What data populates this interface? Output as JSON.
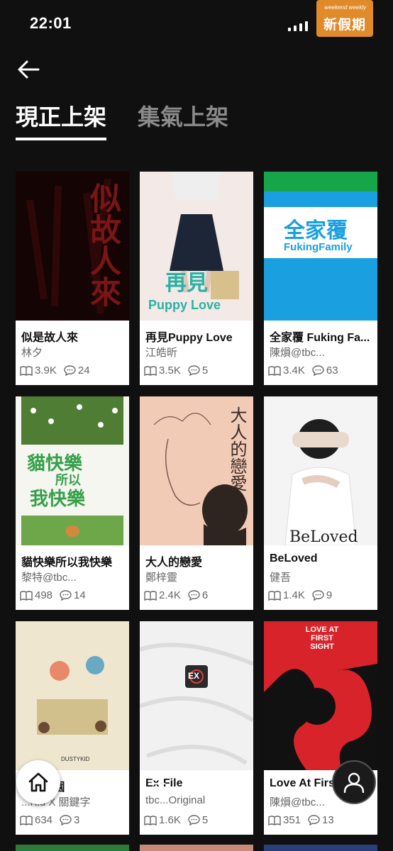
{
  "status_bar": {
    "time": "22:01",
    "logo_text": "新假期",
    "logo_sub": "weekend weekly"
  },
  "header": {
    "back_label": "back"
  },
  "tabs": [
    {
      "label": "現正上架",
      "active": true
    },
    {
      "label": "集氣上架",
      "active": false
    }
  ],
  "books": [
    {
      "title": "似是故人來",
      "author": "林夕",
      "reads": "3.9K",
      "comments": "24",
      "cover_text": "似故人來"
    },
    {
      "title": "再見Puppy Love",
      "author": "江皓昕",
      "reads": "3.5K",
      "comments": "5",
      "cover_text": "再見",
      "cover_sub": "Puppy Love"
    },
    {
      "title": "全家覆 Fuking Fa...",
      "author": "陳熉@tbc...",
      "reads": "3.4K",
      "comments": "63",
      "cover_text": "全家覆",
      "cover_sub": "FukingFamily"
    },
    {
      "title": "貓快樂所以我快樂",
      "author": "黎特@tbc...",
      "reads": "498",
      "comments": "14",
      "cover_text": "貓快樂",
      "cover_sub": "所以",
      "cover_sub2": "我快樂"
    },
    {
      "title": "大人的戀愛",
      "author": "鄭梓靈",
      "reads": "2.4K",
      "comments": "6",
      "cover_text": "大人的戀愛"
    },
    {
      "title": "BeLoved",
      "author": "健吾",
      "reads": "1.4K",
      "comments": "9",
      "cover_text": "BeLoved"
    },
    {
      "title": "...淪落園",
      "author": "...Kid X 關鍵字",
      "reads": "634",
      "comments": "3",
      "cover_text": "DUSTYKID"
    },
    {
      "title": "Ex-File",
      "author": "tbc...Original",
      "reads": "1.6K",
      "comments": "5",
      "cover_text": "EX"
    },
    {
      "title": "Love At Firs...",
      "author": "陳熉@tbc...",
      "reads": "351",
      "comments": "13",
      "cover_text": "LOVE AT FIRST SIGHT"
    }
  ],
  "colors": {
    "background": "#101010",
    "card": "#ffffff",
    "muted_text": "#666666",
    "tab_inactive": "#8b8b8b",
    "logo_orange": "#e08a2b",
    "family_green": "#17a54a",
    "family_blue": "#1aa0e0",
    "love_red": "#d9232a"
  },
  "icons": {
    "back": "arrow-left-icon",
    "reads": "book-open-icon",
    "comments": "comment-icon",
    "home": "home-icon",
    "search": "search-icon",
    "menu": "menu-icon",
    "profile": "profile-icon"
  }
}
